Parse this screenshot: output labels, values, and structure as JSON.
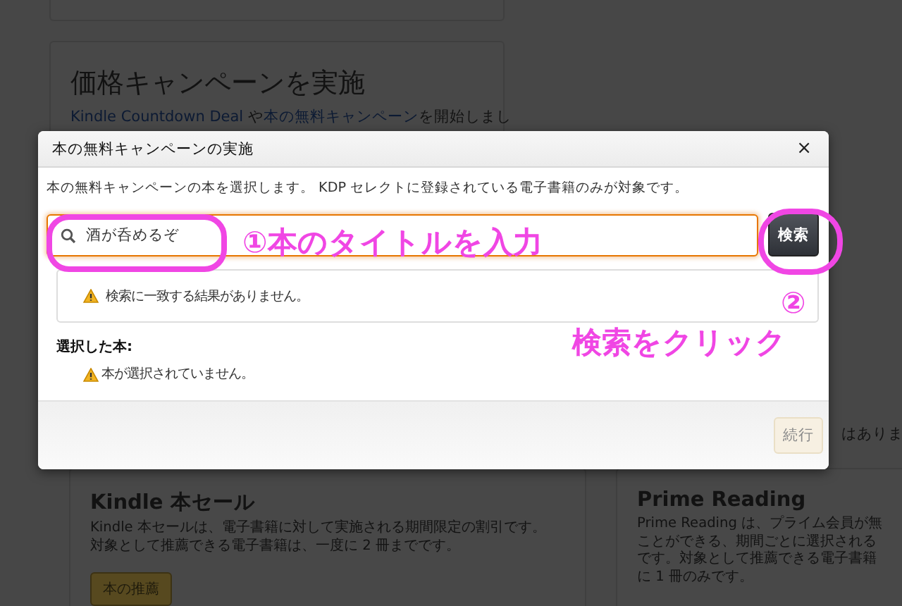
{
  "background": {
    "campaign_card": {
      "title": "価格キャンペーンを実施",
      "link_1": "Kindle Countdown Deal",
      "text_1": " や",
      "link_2": "本の無料キャンペーン",
      "text_2": "を開始しまし"
    },
    "side_text": "はありま",
    "feature_cards": [
      {
        "title": "Kindle 本セール",
        "lines": [
          "Kindle 本セールは、電子書籍に対して実施される期間限定の割引です。",
          "対象として推薦できる電子書籍は、一度に 2 冊までです。"
        ],
        "button": "本の推薦"
      },
      {
        "title": "Prime Reading",
        "lines": [
          "Prime Reading は、プライム会員が無",
          "ことができる、期間ごとに選択される",
          "です。対象として推薦できる電子書籍",
          "に 1 冊のみです。"
        ]
      }
    ]
  },
  "dialog": {
    "title": "本の無料キャンペーンの実施",
    "close": "×",
    "instruction": "本の無料キャンペーンの本を選択します。 KDP セレクトに登録されている電子書籍のみが対象です。",
    "search": {
      "value": "酒が呑めるぞ"
    },
    "search_button": "検索",
    "result_message": "検索に一致する結果がありません。",
    "selected_label": "選択した本:",
    "selected_message": "本が選択されていません。",
    "continue_button": {
      "label": "続行",
      "disabled": true
    }
  },
  "annotations": {
    "step_1": "①本のタイトルを入力",
    "step_2_number": "②",
    "step_2": "検索をクリック"
  }
}
